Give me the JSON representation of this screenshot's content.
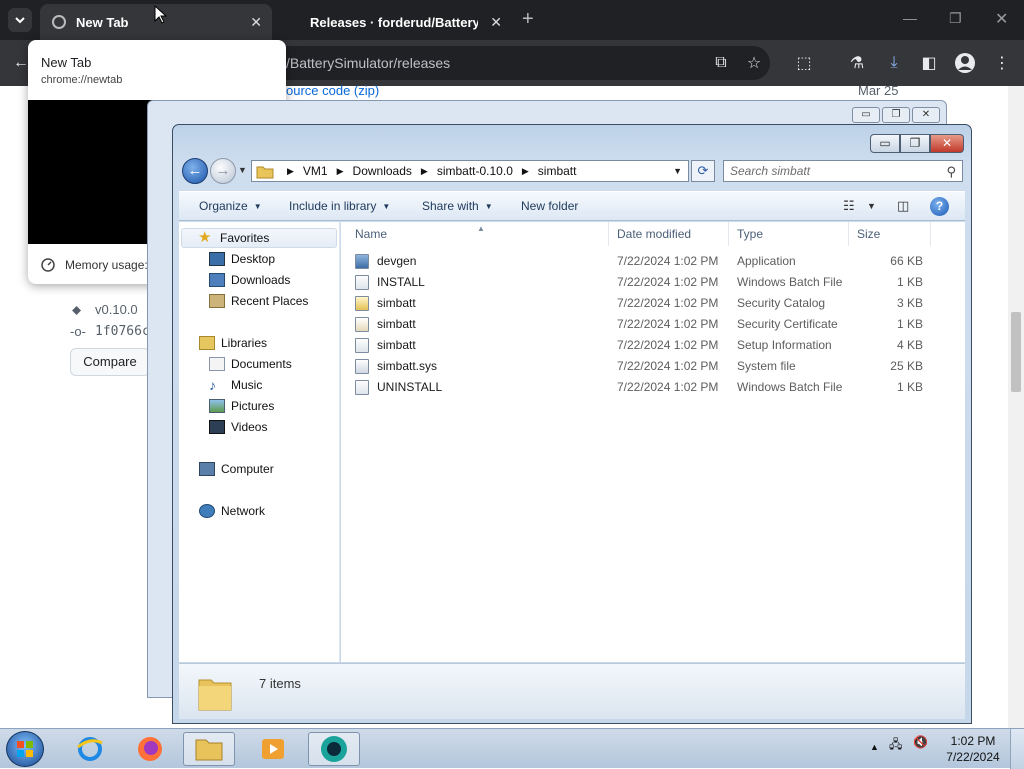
{
  "chrome": {
    "tabs": [
      {
        "title": "New Tab",
        "active": true
      },
      {
        "title": "Releases · forderud/BatterySim",
        "active": false
      }
    ],
    "omnibox_url": "/BatterySimulator/releases",
    "hover_card": {
      "title": "New Tab",
      "url": "chrome://newtab",
      "memory_text": "Memory usage:"
    },
    "page": {
      "source_code_link": "ource code (zip)",
      "release_date": "Mar 25",
      "version": "v0.10.0",
      "commit": "1f0766c",
      "compare_label": "Compare"
    }
  },
  "explorer": {
    "breadcrumbs": [
      "VM1",
      "Downloads",
      "simbatt-0.10.0",
      "simbatt"
    ],
    "search_placeholder": "Search simbatt",
    "commands": {
      "organize": "Organize",
      "include_in_library": "Include in library",
      "share_with": "Share with",
      "new_folder": "New folder"
    },
    "nav": {
      "favorites": "Favorites",
      "favorites_items": [
        "Desktop",
        "Downloads",
        "Recent Places"
      ],
      "libraries": "Libraries",
      "libraries_items": [
        "Documents",
        "Music",
        "Pictures",
        "Videos"
      ],
      "computer": "Computer",
      "network": "Network"
    },
    "columns": {
      "name": "Name",
      "date": "Date modified",
      "type": "Type",
      "size": "Size"
    },
    "files": [
      {
        "name": "devgen",
        "date": "7/22/2024 1:02 PM",
        "type": "Application",
        "size": "66 KB"
      },
      {
        "name": "INSTALL",
        "date": "7/22/2024 1:02 PM",
        "type": "Windows Batch File",
        "size": "1 KB"
      },
      {
        "name": "simbatt",
        "date": "7/22/2024 1:02 PM",
        "type": "Security Catalog",
        "size": "3 KB"
      },
      {
        "name": "simbatt",
        "date": "7/22/2024 1:02 PM",
        "type": "Security Certificate",
        "size": "1 KB"
      },
      {
        "name": "simbatt",
        "date": "7/22/2024 1:02 PM",
        "type": "Setup Information",
        "size": "4 KB"
      },
      {
        "name": "simbatt.sys",
        "date": "7/22/2024 1:02 PM",
        "type": "System file",
        "size": "25 KB"
      },
      {
        "name": "UNINSTALL",
        "date": "7/22/2024 1:02 PM",
        "type": "Windows Batch File",
        "size": "1 KB"
      }
    ],
    "item_count": "7 items"
  },
  "taskbar": {
    "time": "1:02 PM",
    "date": "7/22/2024"
  }
}
